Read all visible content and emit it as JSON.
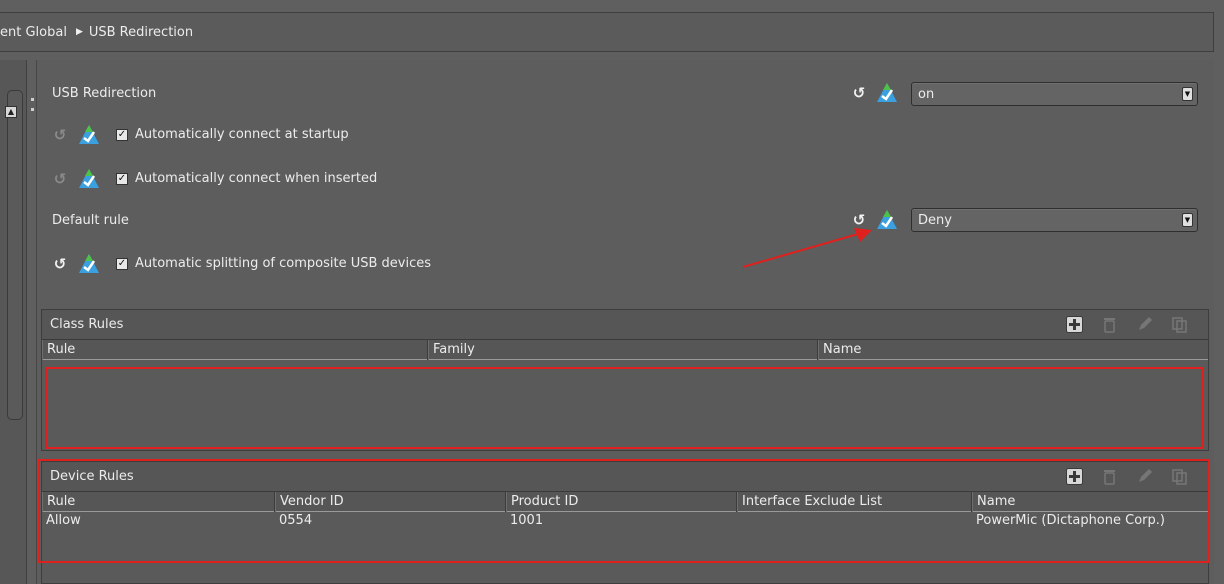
{
  "breadcrumb": {
    "parent": "ent Global",
    "current": "USB Redirection"
  },
  "settings": {
    "usb_redirection": {
      "label": "USB Redirection",
      "value": "on"
    },
    "auto_connect_startup": {
      "label": "Automatically connect at startup",
      "checked": true
    },
    "auto_connect_inserted": {
      "label": "Automatically connect when inserted",
      "checked": true
    },
    "default_rule": {
      "label": "Default rule",
      "value": "Deny"
    },
    "auto_split_composite": {
      "label": "Automatic splitting of composite USB devices",
      "checked": true
    }
  },
  "class_rules": {
    "title": "Class Rules",
    "columns": [
      "Rule",
      "Family",
      "Name"
    ],
    "rows": []
  },
  "device_rules": {
    "title": "Device Rules",
    "columns": [
      "Rule",
      "Vendor ID",
      "Product ID",
      "Interface Exclude List",
      "Name"
    ],
    "rows": [
      [
        "Allow",
        "0554",
        "1001",
        "",
        "PowerMic (Dictaphone Corp.)"
      ]
    ]
  },
  "icons": {
    "reset": "reset-icon",
    "inherit": "inherit-arrow-icon",
    "add": "add-icon",
    "delete": "trash-icon",
    "edit": "pencil-icon",
    "copy": "copy-icon"
  },
  "colors": {
    "highlight_annotation": "#e0201c",
    "panel_bg": "#5f5f5f",
    "inherit_icon_blue": "#3aa0e0",
    "inherit_icon_green": "#4cc24a"
  }
}
